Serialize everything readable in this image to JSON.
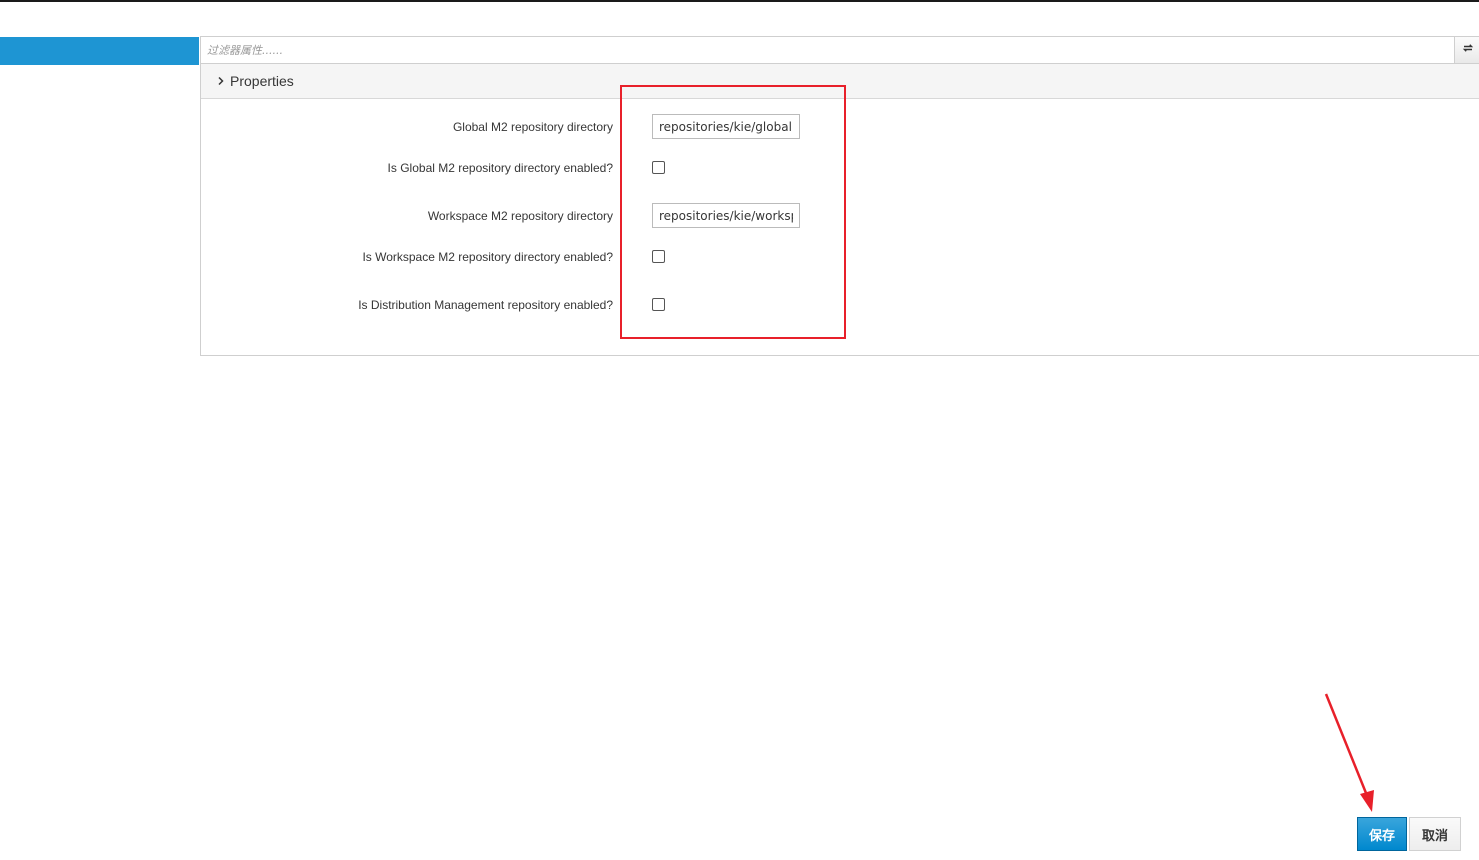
{
  "filter": {
    "placeholder": "过滤器属性......",
    "refresh_icon": "refresh-icon"
  },
  "section": {
    "title": "Properties",
    "chevron_icon": "chevron-right-icon"
  },
  "fields": [
    {
      "label": "Global M2 repository directory",
      "type": "text",
      "value": "repositories/kie/global"
    },
    {
      "label": "Is Global M2 repository directory enabled?",
      "type": "checkbox",
      "checked": false
    },
    {
      "label": "Workspace M2 repository directory",
      "type": "text",
      "value": "repositories/kie/workspace"
    },
    {
      "label": "Is Workspace M2 repository directory enabled?",
      "type": "checkbox",
      "checked": false
    },
    {
      "label": "Is Distribution Management repository enabled?",
      "type": "checkbox",
      "checked": false
    }
  ],
  "actions": {
    "save_label": "保存",
    "cancel_label": "取消"
  },
  "colors": {
    "accent": "#1e95d3",
    "annotation": "#e8202a"
  }
}
